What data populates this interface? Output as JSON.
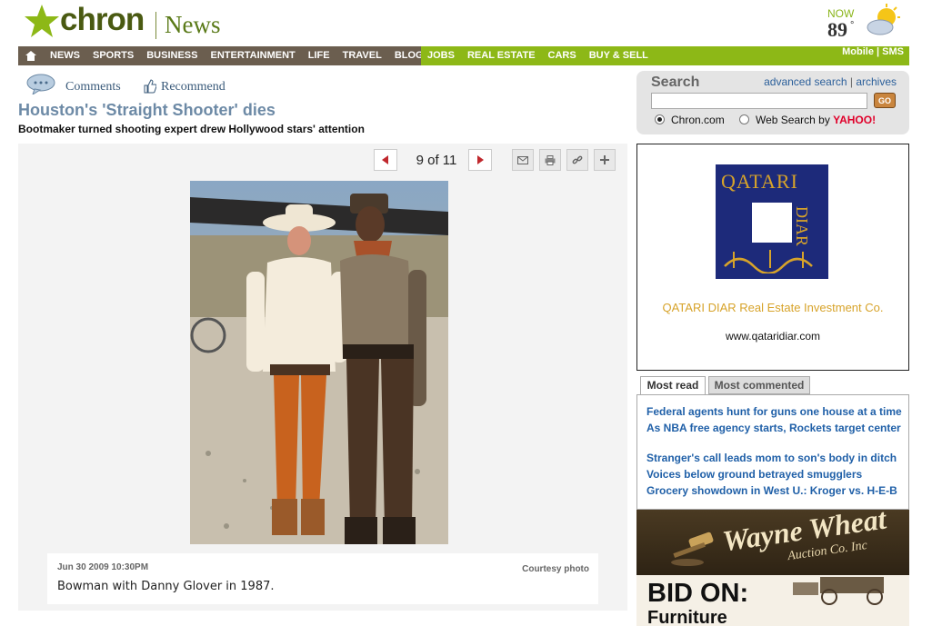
{
  "header": {
    "logo_text": "chron",
    "section": "News",
    "weather": {
      "label": "NOW",
      "temp": "89",
      "degree": "°",
      "icon": "partly-cloudy-icon"
    }
  },
  "nav": {
    "items": [
      "NEWS",
      "SPORTS",
      "BUSINESS",
      "ENTERTAINMENT",
      "LIFE",
      "TRAVEL",
      "BLOGS"
    ],
    "green_items": [
      "JOBS",
      "REAL ESTATE",
      "CARS",
      "BUY & SELL"
    ],
    "right": "Mobile | SMS"
  },
  "article": {
    "comments_label": "Comments",
    "recommend_label": "Recommend",
    "headline": "Houston's 'Straight Shooter' dies",
    "subhead": "Bootmaker turned shooting expert drew Hollywood stars' attention"
  },
  "gallery": {
    "counter": "9 of 11",
    "tools": [
      "email-icon",
      "print-icon",
      "link-icon",
      "plus-icon"
    ],
    "caption_date": "Jun 30 2009 10:30PM",
    "caption_credit": "Courtesy photo",
    "caption_text": "Bowman with Danny Glover in 1987."
  },
  "search": {
    "label": "Search",
    "advanced": "advanced search",
    "sep": " | ",
    "archives": "archives",
    "go": "GO",
    "option1": "Chron.com",
    "option2": "Web Search by",
    "yahoo": "YAHOO!"
  },
  "ad": {
    "logo_line1": "QATARI",
    "logo_side": "DIAR",
    "tagline": "QATARI DIAR Real Estate Investment Co.",
    "url": "www.qataridiar.com"
  },
  "mostread": {
    "tab1": "Most read",
    "tab2": "Most commented",
    "items": [
      "Federal agents hunt for guns one house at a time",
      "As NBA free agency starts, Rockets target center",
      "Stranger's call leads mom to son's body in ditch",
      "Voices below ground betrayed smugglers",
      "Grocery showdown in West U.: Kroger vs. H-E-B"
    ]
  },
  "auction": {
    "name": "Wayne Wheat",
    "sub": "Auction Co. Inc",
    "bid": "BID ON:",
    "item": "Furniture"
  }
}
